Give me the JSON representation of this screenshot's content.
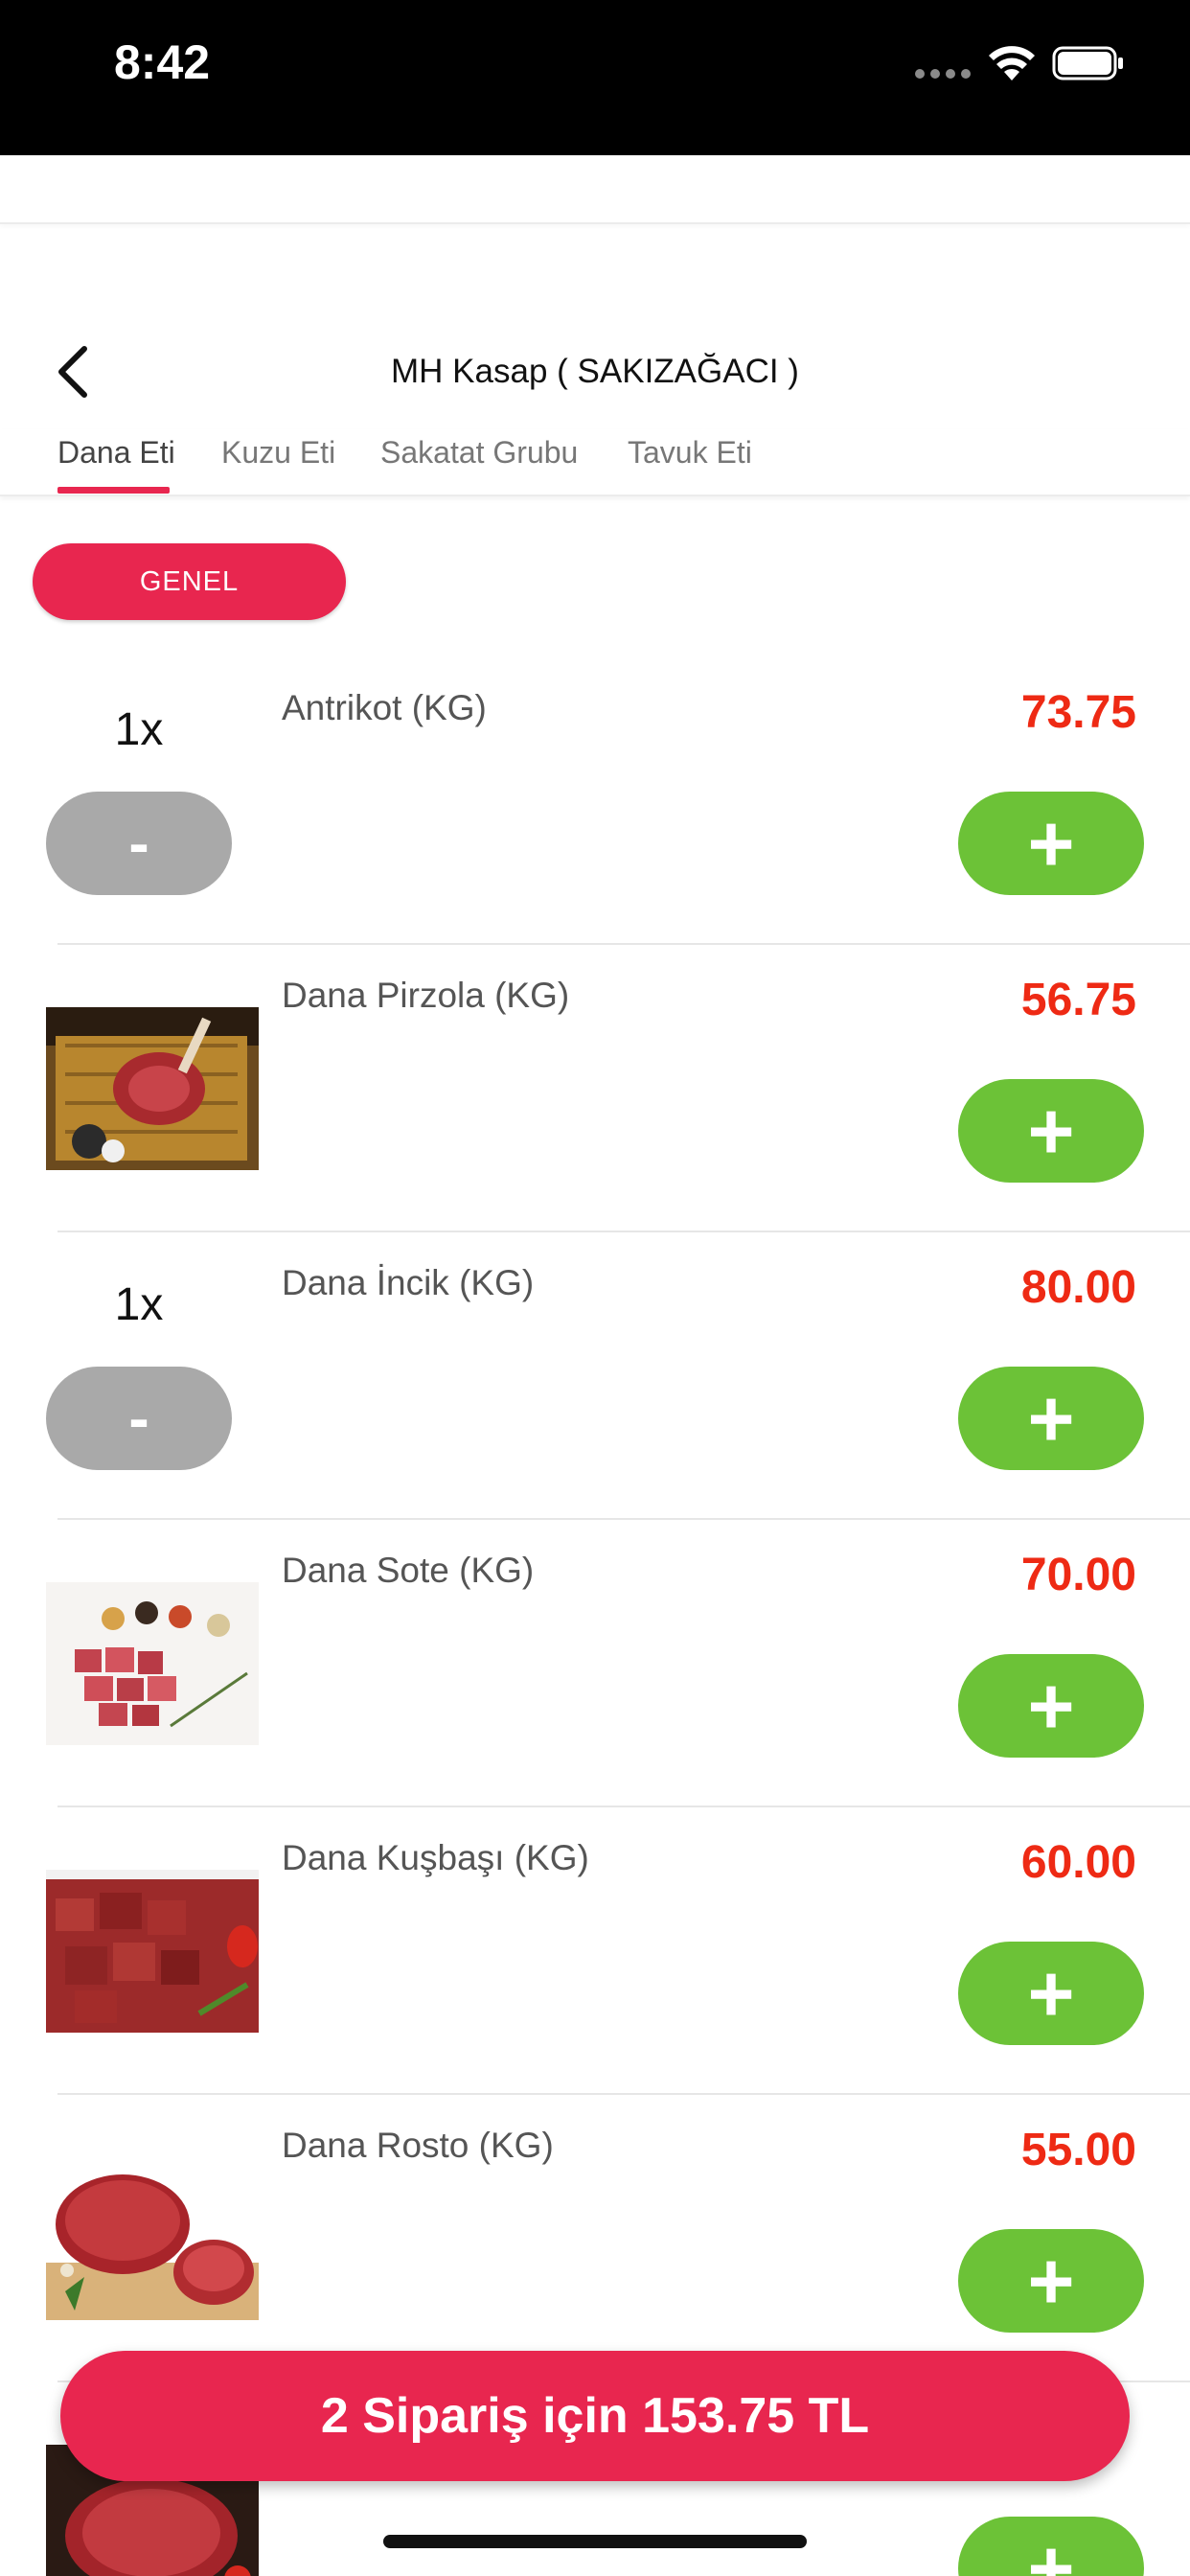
{
  "status_bar": {
    "time": "8:42"
  },
  "header": {
    "title": "MH Kasap ( SAKIZAĞACI )"
  },
  "tabs": [
    {
      "label": "Dana Eti",
      "active": true
    },
    {
      "label": "Kuzu Eti",
      "active": false
    },
    {
      "label": "Sakatat Grubu",
      "active": false
    },
    {
      "label": "Tavuk Eti",
      "active": false
    }
  ],
  "category_pill": {
    "label": "GENEL"
  },
  "items": [
    {
      "name": "Antrikot (KG)",
      "price": "73.75",
      "quantity": "1x",
      "minus_label": "-",
      "plus_label": "+",
      "image": "none"
    },
    {
      "name": "Dana Pirzola (KG)",
      "price": "56.75",
      "plus_label": "+",
      "image": "steak-photo"
    },
    {
      "name": "Dana İncik (KG)",
      "price": "80.00",
      "quantity": "1x",
      "minus_label": "-",
      "plus_label": "+",
      "image": "none"
    },
    {
      "name": "Dana Sote (KG)",
      "price": "70.00",
      "plus_label": "+",
      "image": "cubed-meat-photo"
    },
    {
      "name": "Dana Kuşbaşı (KG)",
      "price": "60.00",
      "plus_label": "+",
      "image": "diced-beef-photo"
    },
    {
      "name": "Dana Rosto (KG)",
      "price": "55.00",
      "plus_label": "+",
      "image": "roast-beef-photo"
    },
    {
      "name": "",
      "price": "",
      "plus_label": "+",
      "image": "beef-cut-photo"
    }
  ],
  "order_button": {
    "label": "2 Sipariş için 153.75 TL"
  },
  "colors": {
    "accent": "#e8264f",
    "price": "#ee2a14",
    "plus": "#6cc237",
    "minus": "#a9a9a9"
  }
}
